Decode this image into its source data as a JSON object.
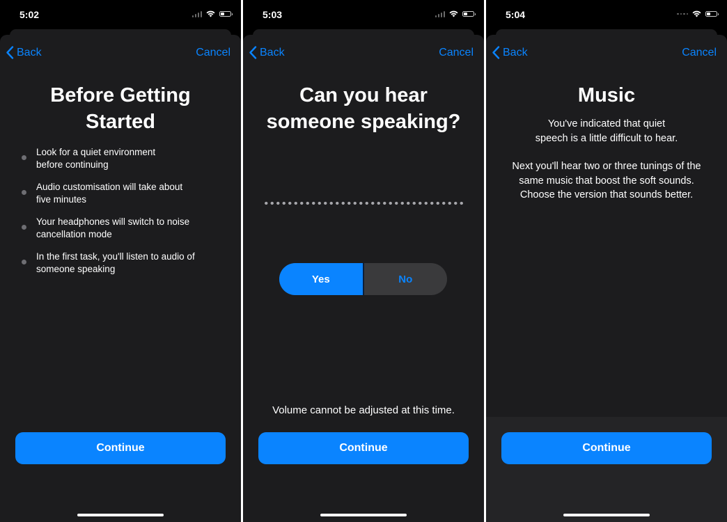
{
  "screens": [
    {
      "time": "5:02",
      "nav": {
        "back": "Back",
        "cancel": "Cancel"
      },
      "title_lines": [
        "Before Getting",
        "Started"
      ],
      "bullets": [
        [
          "Look for a quiet environment",
          "before continuing"
        ],
        [
          "Audio customisation will take about",
          "five minutes"
        ],
        [
          "Your headphones will switch to noise",
          "cancellation mode"
        ],
        [
          "In the first task, you'll listen to audio of",
          "someone speaking"
        ]
      ],
      "continue": "Continue"
    },
    {
      "time": "5:03",
      "nav": {
        "back": "Back",
        "cancel": "Cancel"
      },
      "title_lines": [
        "Can you hear",
        "someone speaking?"
      ],
      "segmented": {
        "yes": "Yes",
        "no": "No",
        "selected": "Yes"
      },
      "volume_note": "Volume cannot be adjusted at this time.",
      "continue": "Continue"
    },
    {
      "time": "5:04",
      "nav": {
        "back": "Back",
        "cancel": "Cancel"
      },
      "title_lines": [
        "Music"
      ],
      "paragraph1": [
        "You've indicated that quiet",
        "speech is a little difficult to hear."
      ],
      "paragraph2": [
        "Next you'll hear two or three tunings of the",
        "same music that boost the soft sounds.",
        "Choose the version that sounds better."
      ],
      "continue": "Continue"
    }
  ],
  "colors": {
    "accent": "#0a84ff",
    "sheet": "#1c1c1e",
    "background": "#000000"
  },
  "icons": {
    "back": "chevron-left-icon",
    "wifi": "wifi-icon",
    "battery": "battery-icon",
    "signal": "cellular-signal-icon"
  }
}
